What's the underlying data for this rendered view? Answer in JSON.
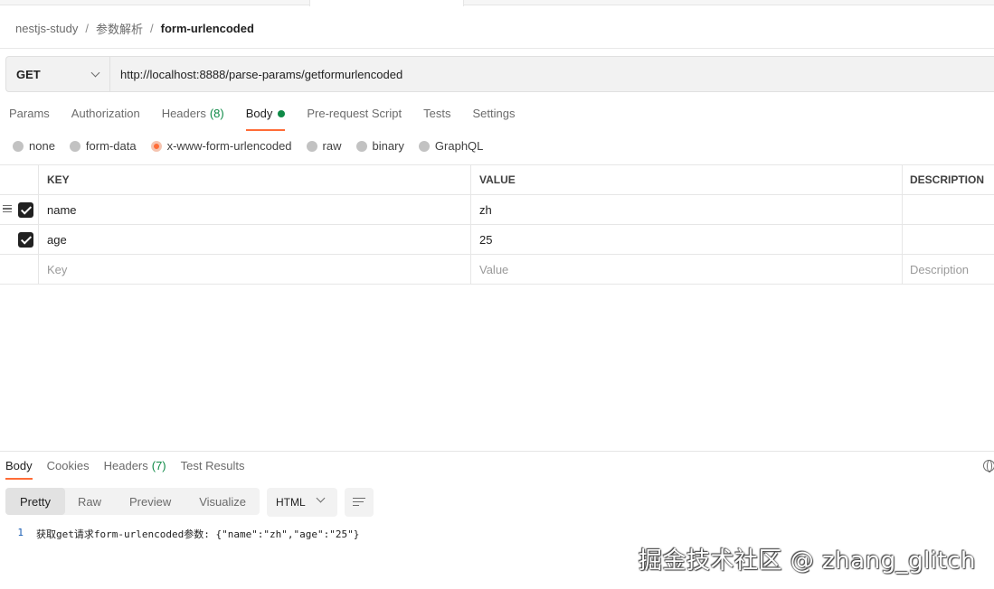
{
  "breadcrumb": {
    "items": [
      "nestjs-study",
      "参数解析"
    ],
    "current": "form-urlencoded",
    "separator": "/"
  },
  "request": {
    "method": "GET",
    "url": "http://localhost:8888/parse-params/getformurlencoded"
  },
  "request_tabs": {
    "params": "Params",
    "authorization": "Authorization",
    "headers": "Headers",
    "headers_count": "(8)",
    "body": "Body",
    "pre_request": "Pre-request Script",
    "tests": "Tests",
    "settings": "Settings",
    "active": "Body"
  },
  "body_types": {
    "none": "none",
    "form_data": "form-data",
    "x_www_form_urlencoded": "x-www-form-urlencoded",
    "raw": "raw",
    "binary": "binary",
    "graphql": "GraphQL",
    "selected": "x-www-form-urlencoded"
  },
  "table": {
    "headers": {
      "key": "KEY",
      "value": "VALUE",
      "description": "DESCRIPTION"
    },
    "rows": [
      {
        "key": "name",
        "value": "zh",
        "description": "",
        "checked": true
      },
      {
        "key": "age",
        "value": "25",
        "description": "",
        "checked": true
      }
    ],
    "placeholder": {
      "key": "Key",
      "value": "Value",
      "description": "Description"
    }
  },
  "response_tabs": {
    "body": "Body",
    "cookies": "Cookies",
    "headers": "Headers",
    "headers_count": "(7)",
    "test_results": "Test Results",
    "active": "Body"
  },
  "view_modes": {
    "pretty": "Pretty",
    "raw": "Raw",
    "preview": "Preview",
    "visualize": "Visualize",
    "active": "Pretty"
  },
  "format": "HTML",
  "response_body": {
    "line_number": "1",
    "text": "获取get请求form-urlencoded参数: {\"name\":\"zh\",\"age\":\"25\"}"
  },
  "watermark": "掘金技术社区 @ zhang_glitch",
  "colors": {
    "accent": "#ff6c37",
    "green": "#0f8a47"
  }
}
